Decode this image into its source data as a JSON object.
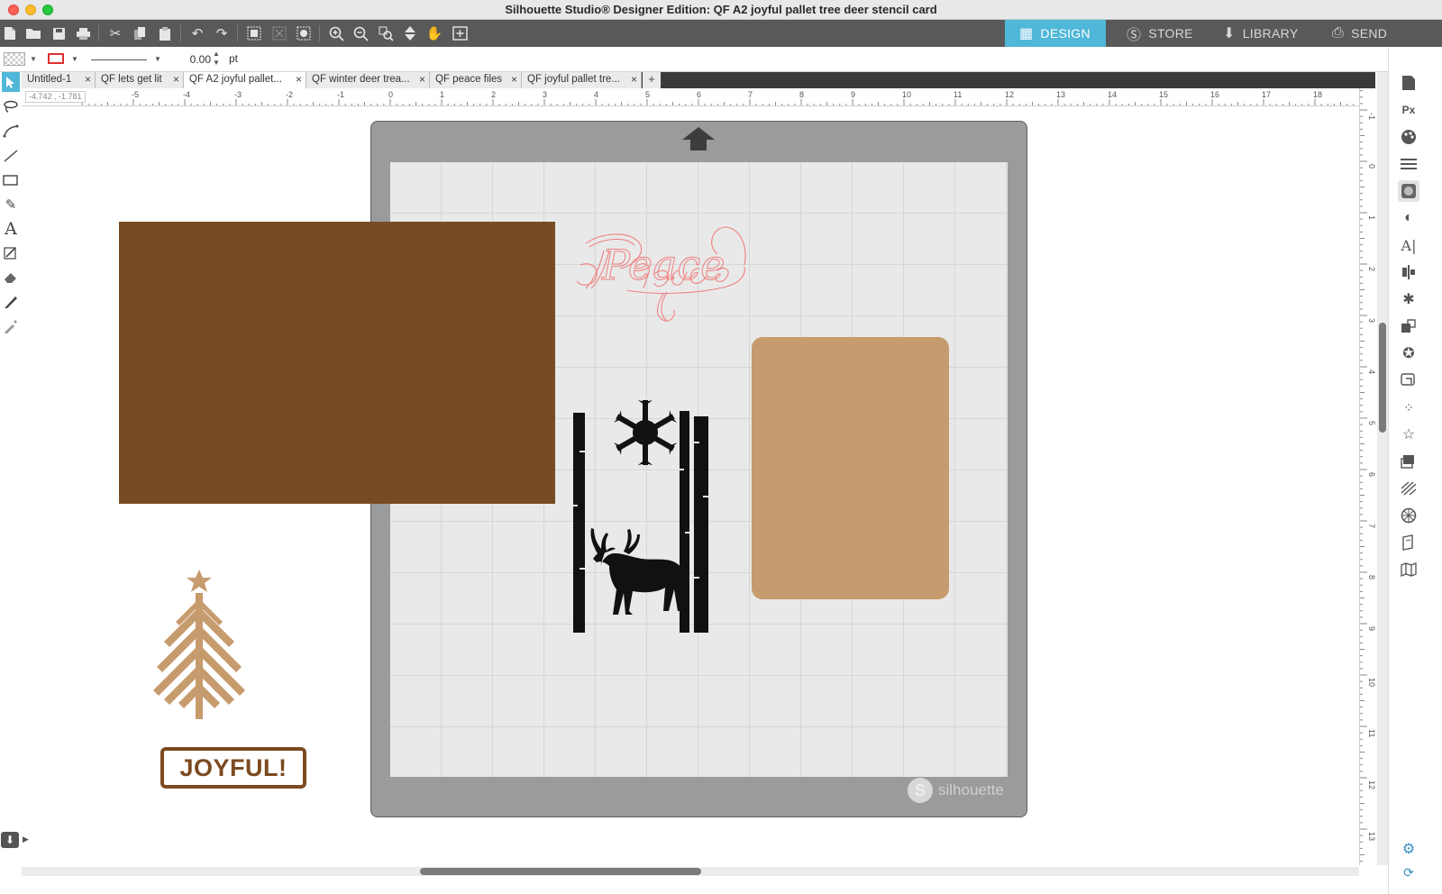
{
  "window": {
    "title": "Silhouette Studio® Designer Edition: QF  A2 joyful pallet tree  deer stencil card"
  },
  "nav_tabs": [
    {
      "label": "DESIGN",
      "icon": "grid-icon",
      "active": true
    },
    {
      "label": "STORE",
      "icon": "silhouette-s-icon",
      "active": false
    },
    {
      "label": "LIBRARY",
      "icon": "download-icon",
      "active": false
    },
    {
      "label": "SEND",
      "icon": "cutter-icon",
      "active": false
    }
  ],
  "properties": {
    "line_width": "0.00",
    "unit": "pt",
    "line_color": "#e03030"
  },
  "doc_tabs": [
    {
      "label": "Untitled-1",
      "active": false
    },
    {
      "label": "QF lets get lit",
      "active": false
    },
    {
      "label": "QF  A2 joyful pallet...",
      "active": true
    },
    {
      "label": "QF winter deer trea...",
      "active": false
    },
    {
      "label": "QF peace files",
      "active": false
    },
    {
      "label": "QF joyful pallet tre...",
      "active": false
    }
  ],
  "add_tab_label": "+",
  "coordinates": "-4.742 , -1.781",
  "ruler": {
    "horizontal": [
      "-5",
      "-4",
      "-3",
      "-2",
      "-1",
      "0",
      "1",
      "2",
      "3",
      "4",
      "5",
      "6",
      "7",
      "8",
      "9",
      "10",
      "11",
      "12",
      "13",
      "14",
      "15",
      "16",
      "17",
      "18"
    ],
    "vertical": [
      "-1",
      "0",
      "1",
      "2",
      "3",
      "4",
      "5",
      "6",
      "7",
      "8",
      "9",
      "10",
      "11",
      "12",
      "13"
    ]
  },
  "canvas": {
    "peace_text": "Peace",
    "joyful_text": "JOYFUL!",
    "watermark": "silhouette",
    "colors": {
      "brown_rect": "#774c24",
      "tan_rect": "#c69b6d",
      "tree": "#c69b6d",
      "peace_outline": "#f08080",
      "stencil": "#111111"
    }
  },
  "accent_color": "#4fb7d8"
}
